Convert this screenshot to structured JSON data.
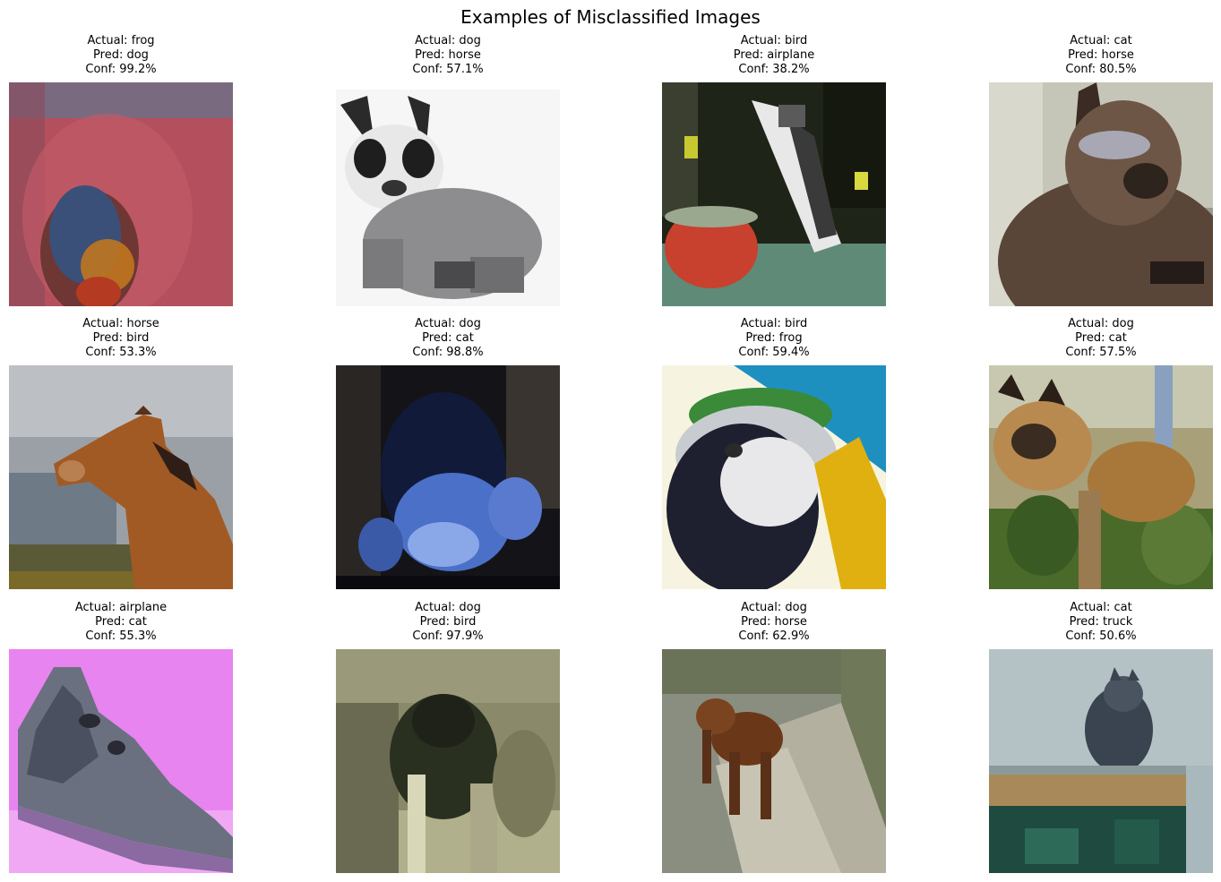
{
  "figure": {
    "title": "Examples of Misclassified Images"
  },
  "items": [
    {
      "actual": "Actual: frog",
      "pred": "Pred: dog",
      "conf": "Conf: 99.2%",
      "image": "frog-on-red-background"
    },
    {
      "actual": "Actual: dog",
      "pred": "Pred: horse",
      "conf": "Conf: 57.1%",
      "image": "dog-in-grey-sweater"
    },
    {
      "actual": "Actual: bird",
      "pred": "Pred: airplane",
      "conf": "Conf: 38.2%",
      "image": "bird-perched-by-red-bowl"
    },
    {
      "actual": "Actual: cat",
      "pred": "Pred: horse",
      "conf": "Conf: 80.5%",
      "image": "brown-siamese-cat"
    },
    {
      "actual": "Actual: horse",
      "pred": "Pred: bird",
      "conf": "Conf: 53.3%",
      "image": "brown-horse-under-cloudy-sky"
    },
    {
      "actual": "Actual: dog",
      "pred": "Pred: cat",
      "conf": "Conf: 98.8%",
      "image": "dark-blue-tinted-dog"
    },
    {
      "actual": "Actual: bird",
      "pred": "Pred: frog",
      "conf": "Conf: 59.4%",
      "image": "macaw-parrot-closeup"
    },
    {
      "actual": "Actual: dog",
      "pred": "Pred: cat",
      "conf": "Conf: 57.5%",
      "image": "german-shepherd-in-grass"
    },
    {
      "actual": "Actual: airplane",
      "pred": "Pred: cat",
      "conf": "Conf: 55.3%",
      "image": "stealth-bomber-on-pink"
    },
    {
      "actual": "Actual: dog",
      "pred": "Pred: bird",
      "conf": "Conf: 97.9%",
      "image": "dark-dog-in-olive-scene"
    },
    {
      "actual": "Actual: dog",
      "pred": "Pred: horse",
      "conf": "Conf: 62.9%",
      "image": "brown-dog-on-path"
    },
    {
      "actual": "Actual: cat",
      "pred": "Pred: truck",
      "conf": "Conf: 50.6%",
      "image": "grey-cat-on-shelf"
    }
  ]
}
